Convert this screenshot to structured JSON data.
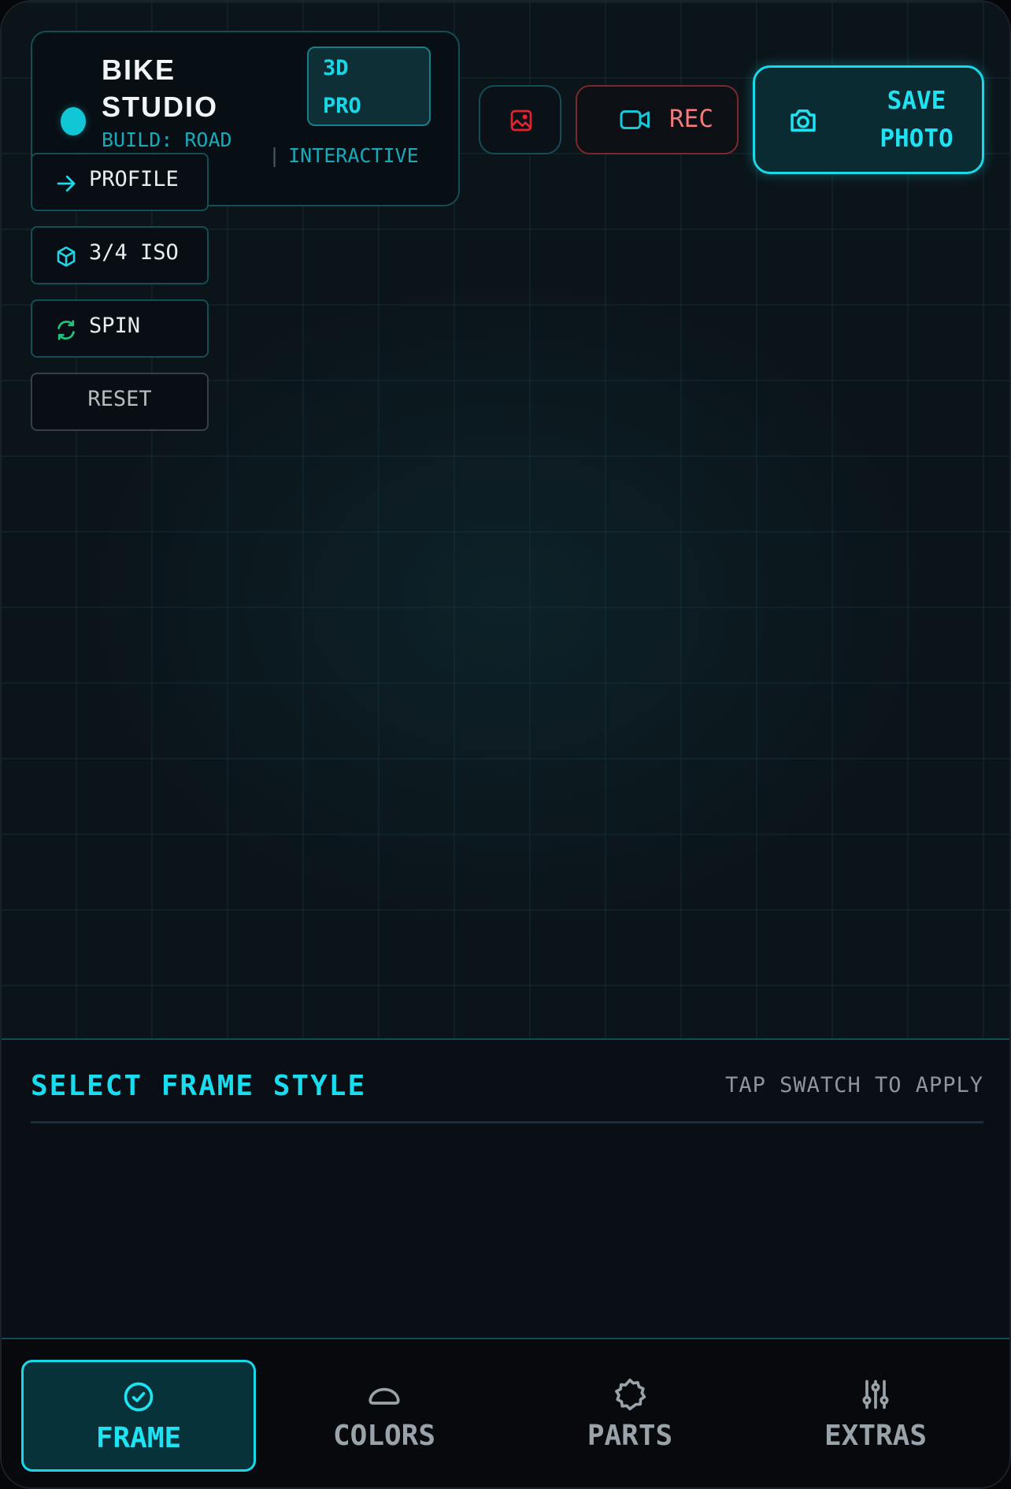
{
  "app": {
    "title_line1": "BIKE",
    "title_line2": "STUDIO",
    "build": "BUILD: ROAD",
    "badge_line1": "3D",
    "badge_line2": "PRO",
    "mode_separator": "|",
    "mode": "INTERACTIVE"
  },
  "view_controls": [
    {
      "label": "PROFILE",
      "icon": "arrow-right-icon"
    },
    {
      "label": "3/4 ISO",
      "icon": "cube-icon"
    },
    {
      "label": "SPIN",
      "icon": "refresh-icon"
    },
    {
      "label": "RESET",
      "icon": ""
    }
  ],
  "actions": {
    "gallery_icon": "image-icon",
    "rec_label": "REC",
    "save_line1": "SAVE",
    "save_line2": "PHOTO"
  },
  "panel": {
    "title": "SELECT FRAME STYLE",
    "hint": "TAP SWATCH TO APPLY"
  },
  "tabs": [
    {
      "label": "FRAME",
      "icon": "check-circle-icon",
      "active": true
    },
    {
      "label": "COLORS",
      "icon": "cloud-icon",
      "active": false
    },
    {
      "label": "PARTS",
      "icon": "gear-icon",
      "active": false
    },
    {
      "label": "EXTRAS",
      "icon": "sliders-icon",
      "active": false
    }
  ],
  "colors": {
    "accent": "#17d9ea",
    "record": "#f27a7a",
    "background": "#0a0f15"
  }
}
